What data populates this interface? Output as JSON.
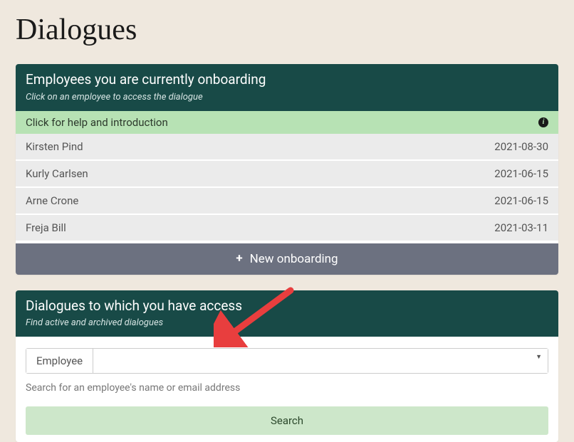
{
  "page": {
    "title": "Dialogues"
  },
  "onboarding": {
    "header_title": "Employees you are currently onboarding",
    "header_subtitle": "Click on an employee to access the dialogue",
    "help_label": "Click for help and introduction",
    "rows": [
      {
        "name": "Kirsten Pind",
        "date": "2021-08-30"
      },
      {
        "name": "Kurly Carlsen",
        "date": "2021-06-15"
      },
      {
        "name": "Arne Crone",
        "date": "2021-06-15"
      },
      {
        "name": "Freja Bill",
        "date": "2021-03-11"
      }
    ],
    "new_label": "New onboarding"
  },
  "access": {
    "header_title": "Dialogues to which you have access",
    "header_subtitle": "Find active and archived dialogues",
    "combo_label": "Employee",
    "combo_value": "",
    "hint": "Search for an employee's name or email address",
    "search_label": "Search"
  },
  "annotation": {
    "arrow_color": "#e83e3e"
  }
}
